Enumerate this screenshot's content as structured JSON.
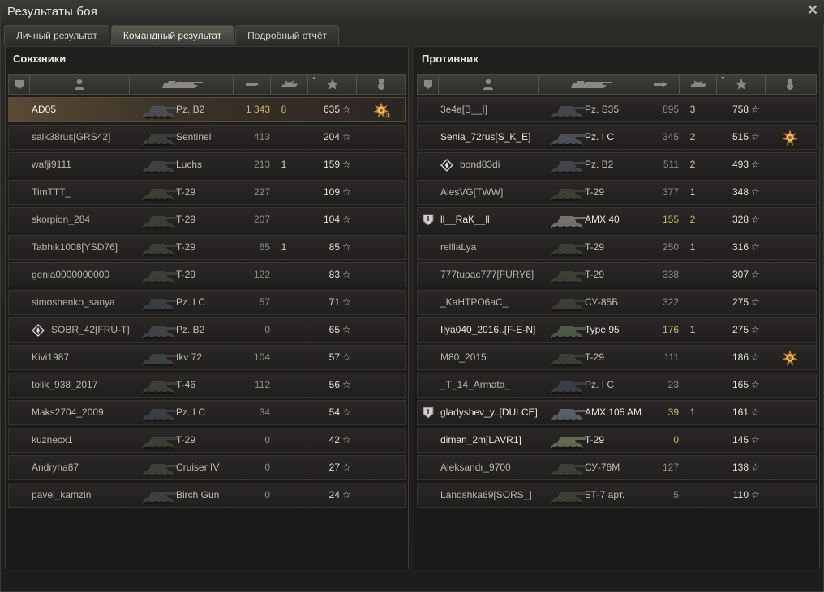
{
  "window": {
    "title": "Результаты боя",
    "close": "✕"
  },
  "tabs": [
    {
      "label": "Личный результат",
      "active": false
    },
    {
      "label": "Командный результат",
      "active": true
    },
    {
      "label": "Подробный отчёт",
      "active": false
    }
  ],
  "allies": {
    "title": "Союзники",
    "rows": [
      {
        "player": "AD05",
        "tank": "Pz. B2",
        "damage": "1 343",
        "kills": "8",
        "xp": "635",
        "me": true,
        "medal": "hero-medal",
        "medal_count": "3",
        "tank_color": "#4a4e55"
      },
      {
        "player": "salk38rus[GRS42]",
        "tank": "Sentinel",
        "damage": "413",
        "kills": "",
        "xp": "204",
        "tank_color": "#3d4039"
      },
      {
        "player": "wafji9111",
        "tank": "Luchs",
        "damage": "213",
        "kills": "1",
        "xp": "159",
        "tank_color": "#3f4144"
      },
      {
        "player": "TimTTT_",
        "tank": "T-29",
        "damage": "227",
        "kills": "",
        "xp": "109",
        "tank_color": "#3b4035"
      },
      {
        "player": "skorpion_284",
        "tank": "T-29",
        "damage": "207",
        "kills": "",
        "xp": "104",
        "tank_color": "#3b4035"
      },
      {
        "player": "Tabhik1008[YSD76]",
        "tank": "T-29",
        "damage": "65",
        "kills": "1",
        "xp": "85",
        "tank_color": "#3b4035"
      },
      {
        "player": "genia0000000000",
        "tank": "T-29",
        "damage": "122",
        "kills": "",
        "xp": "83",
        "tank_color": "#3b4035"
      },
      {
        "player": "simoshenko_sanya",
        "tank": "Pz. I C",
        "damage": "57",
        "kills": "",
        "xp": "71",
        "tank_color": "#3a3e46"
      },
      {
        "player": "SOBR_42[FRU-T]",
        "tank": "Pz. B2",
        "damage": "0",
        "kills": "",
        "xp": "65",
        "rank": true,
        "tank_color": "#41444a"
      },
      {
        "player": "Kivi1987",
        "tank": "Ikv 72",
        "damage": "104",
        "kills": "",
        "xp": "57",
        "tank_color": "#3d4142"
      },
      {
        "player": "tolik_938_2017",
        "tank": "T-46",
        "damage": "112",
        "kills": "",
        "xp": "56",
        "tank_color": "#3b4035"
      },
      {
        "player": "Maks2704_2009",
        "tank": "Pz. I C",
        "damage": "34",
        "kills": "",
        "xp": "54",
        "tank_color": "#3a3e46"
      },
      {
        "player": "kuznecx1",
        "tank": "T-29",
        "damage": "0",
        "kills": "",
        "xp": "42",
        "tank_color": "#3b4035"
      },
      {
        "player": "Andryha87",
        "tank": "Cruiser IV",
        "damage": "0",
        "kills": "",
        "xp": "27",
        "tank_color": "#3e413a"
      },
      {
        "player": "pavel_kamzin",
        "tank": "Birch Gun",
        "damage": "0",
        "kills": "",
        "xp": "24",
        "tank_color": "#403f3c"
      }
    ]
  },
  "enemies": {
    "title": "Противник",
    "rows": [
      {
        "player": "3e4a[B__I]",
        "tank": "Pz. S35",
        "damage": "895",
        "kills": "3",
        "xp": "758",
        "tank_color": "#43464a"
      },
      {
        "player": "Senia_72rus[S_K_E]",
        "tank": "Pz. I C",
        "damage": "345",
        "kills": "2",
        "xp": "515",
        "medal": "hero-medal",
        "bright": true,
        "tank_color": "#4c5058"
      },
      {
        "player": "bond83di",
        "tank": "Pz. B2",
        "damage": "511",
        "kills": "2",
        "xp": "493",
        "rank": true,
        "tank_color": "#41444a"
      },
      {
        "player": "AlesVG[TWW]",
        "tank": "T-29",
        "damage": "377",
        "kills": "1",
        "xp": "348",
        "tank_color": "#3b4035"
      },
      {
        "player": "ll__RaK__ll",
        "tank": "AMX 40",
        "damage": "155",
        "kills": "2",
        "xp": "328",
        "badge": true,
        "bright": true,
        "dmg_hi": true,
        "kills_hi": true,
        "tank_color": "#70736e"
      },
      {
        "player": "relllaLya",
        "tank": "T-29",
        "damage": "250",
        "kills": "1",
        "xp": "316",
        "tank_color": "#3b4035"
      },
      {
        "player": "777tupac777[FURY6]",
        "tank": "T-29",
        "damage": "338",
        "kills": "",
        "xp": "307",
        "tank_color": "#3b4035"
      },
      {
        "player": "_KaHTPO6aC_",
        "tank": "СУ-85Б",
        "damage": "322",
        "kills": "",
        "xp": "275",
        "tank_color": "#3b4035"
      },
      {
        "player": "Ilya040_2016..[F-E-N]",
        "tank": "Type 95",
        "damage": "176",
        "kills": "1",
        "xp": "275",
        "bright": true,
        "dmg_hi": true,
        "tank_color": "#4e5a45"
      },
      {
        "player": "M80_2015",
        "tank": "T-29",
        "damage": "111",
        "kills": "",
        "xp": "186",
        "medal": "hero-medal",
        "tank_color": "#3b4035"
      },
      {
        "player": "_T_14_Armata_",
        "tank": "Pz. I C",
        "damage": "23",
        "kills": "",
        "xp": "165",
        "tank_color": "#3a3e46"
      },
      {
        "player": "gladyshev_y..[DULCE]",
        "tank": "AMX 105 AM",
        "damage": "39",
        "kills": "1",
        "xp": "161",
        "badge": true,
        "bright": true,
        "dmg_hi": true,
        "tank_color": "#5b6068"
      },
      {
        "player": "diman_2m[LAVR1]",
        "tank": "T-29",
        "damage": "0",
        "kills": "",
        "xp": "145",
        "bright": true,
        "dmg_hi": true,
        "tank_color": "#626b50"
      },
      {
        "player": "Aleksandr_9700",
        "tank": "СУ-76М",
        "damage": "127",
        "kills": "",
        "xp": "138",
        "tank_color": "#3b4035"
      },
      {
        "player": "Lanoshka69[SORS_]",
        "tank": "БТ-7 арт.",
        "damage": "5",
        "kills": "",
        "xp": "110",
        "tank_color": "#3b4035"
      }
    ]
  },
  "star_glyph": "☆",
  "colors": {
    "accent": "#d3b06a",
    "panel": "#1f1f1d",
    "row": "#262322",
    "me_row": "#5a4a36"
  }
}
